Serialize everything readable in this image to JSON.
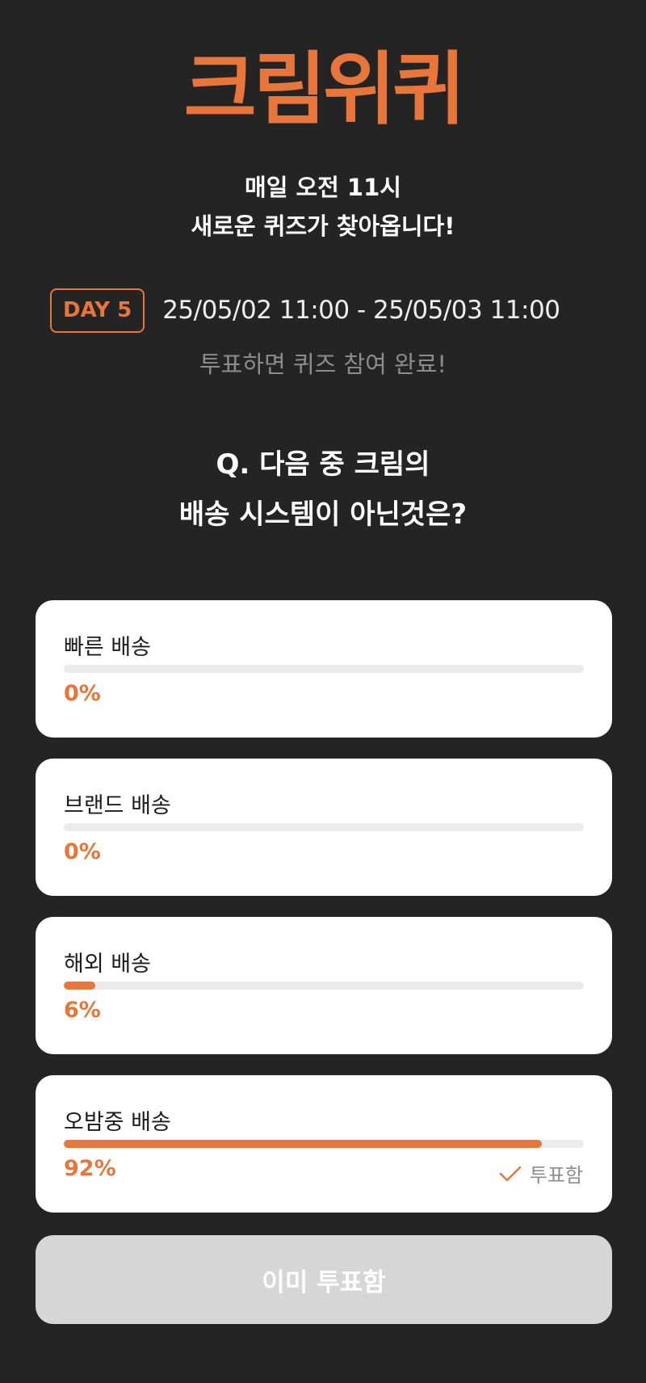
{
  "logo": {
    "text": "크림위퀴"
  },
  "header": {
    "tagline_line1": "매일 오전 11시",
    "tagline_line2": "새로운 퀴즈가 찾아옵니다!"
  },
  "schedule": {
    "day_badge": "DAY 5",
    "period": "25/05/02 11:00 - 25/05/03 11:00"
  },
  "note": "투표하면 퀴즈 참여 완료!",
  "question": {
    "line1": "Q. 다음 중 크림의",
    "line2": "배송 시스템이 아닌것은?"
  },
  "options": [
    {
      "label": "빠른 배송",
      "percent_text": "0%",
      "percent": 0,
      "voted": false
    },
    {
      "label": "브랜드 배송",
      "percent_text": "0%",
      "percent": 0,
      "voted": false
    },
    {
      "label": "해외 배송",
      "percent_text": "6%",
      "percent": 6,
      "voted": false
    },
    {
      "label": "오밤중 배송",
      "percent_text": "92%",
      "percent": 92,
      "voted": true,
      "voted_label": "투표함"
    }
  ],
  "submit": {
    "label": "이미 투표함",
    "disabled": true
  },
  "colors": {
    "accent": "#e8763a",
    "background": "#242424",
    "card": "#ffffff",
    "track": "#ebebeb",
    "muted_text": "#8c8c8c",
    "disabled_button": "#d6d6d6"
  },
  "icons": {
    "voted_check": "check-icon"
  }
}
